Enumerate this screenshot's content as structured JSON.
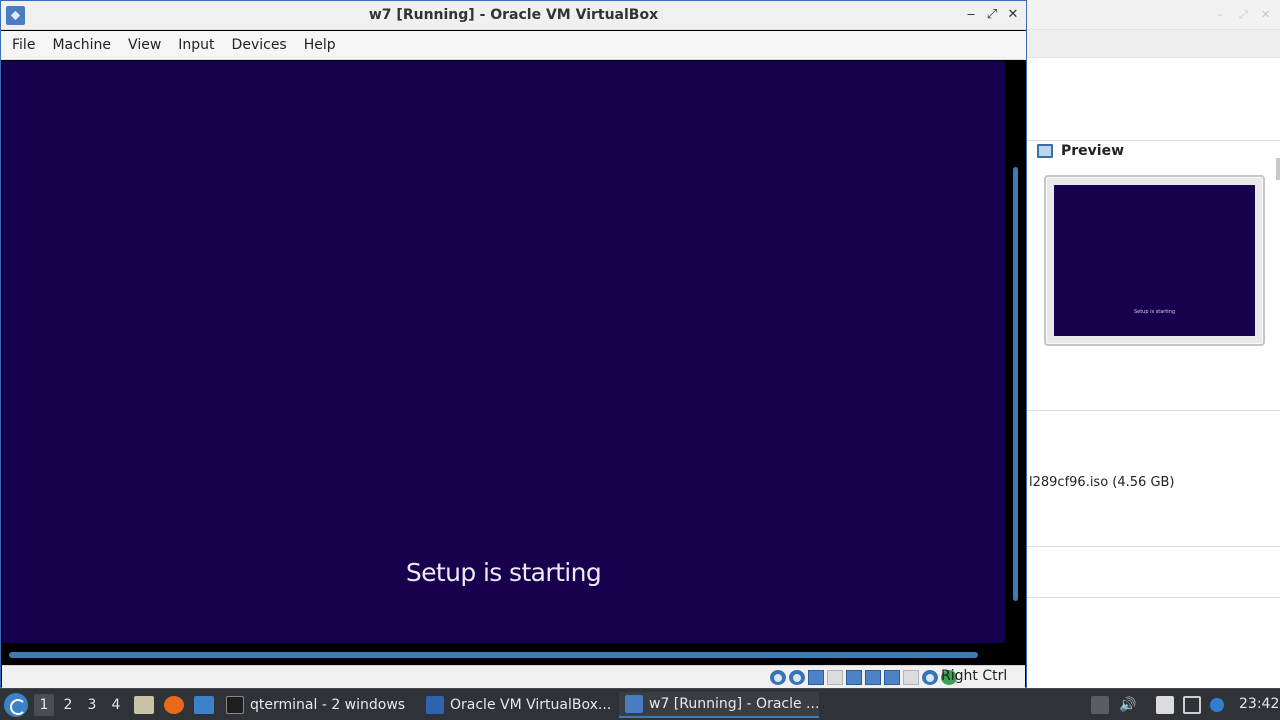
{
  "vm_window": {
    "title": "w7 [Running] - Oracle VM VirtualBox",
    "menu": [
      "File",
      "Machine",
      "View",
      "Input",
      "Devices",
      "Help"
    ],
    "guest_screen_text": "Setup is starting",
    "status_host_key": "Right Ctrl",
    "controls": {
      "minimize": "‒",
      "restore": "⤢",
      "close": "✕"
    }
  },
  "manager_window": {
    "preview_title": "Preview",
    "preview_screen_text": "Setup is starting",
    "iso_text": "l289cf96.iso (4.56 GB)"
  },
  "taskbar": {
    "workspaces": [
      "1",
      "2",
      "3",
      "4"
    ],
    "tasks": [
      {
        "label": "qterminal - 2 windows",
        "icon": "terminal-icon"
      },
      {
        "label": "Oracle VM VirtualBox...",
        "icon": "virtualbox-icon"
      },
      {
        "label": "w7 [Running] - Oracle ...",
        "icon": "virtualbox-vm-icon"
      }
    ],
    "clock": "23:42"
  },
  "colors": {
    "guest_background": "#17004e",
    "accent": "#3c7bb5",
    "taskbar": "#2f3236"
  }
}
